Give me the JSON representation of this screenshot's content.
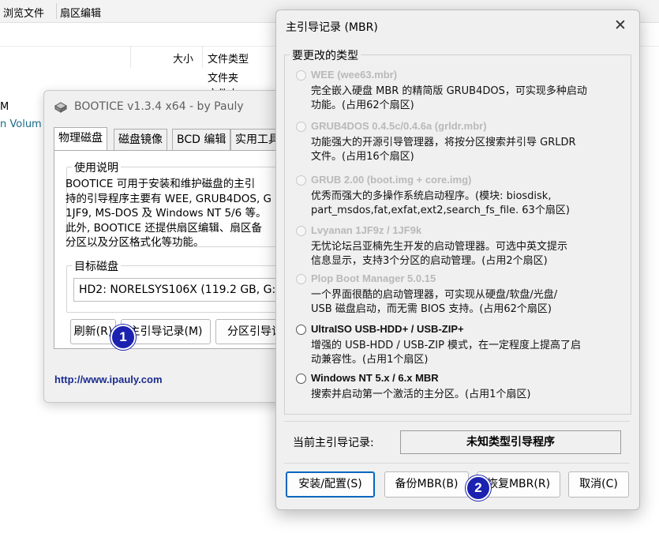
{
  "explorer": {
    "menu": [
      "浏览文件",
      "扇区编辑"
    ],
    "columns": {
      "size": "大小",
      "type": "文件类型"
    },
    "rows": [
      "文件夹",
      "文件夹"
    ],
    "left_text_1": "M",
    "left_text_2": "n Volum"
  },
  "bootice": {
    "title": "BOOTICE v1.3.4 x64 - by Pauly",
    "tabs": [
      "物理磁盘",
      "磁盘镜像",
      "BCD 编辑",
      "实用工具"
    ],
    "usage_label": "使用说明",
    "usage_text": "BOOTICE 可用于安装和维护磁盘的主引\n持的引导程序主要有 WEE, GRUB4DOS, G\n1JF9, MS-DOS 及 Windows NT 5/6 等。\n此外, BOOTICE 还提供扇区编辑、扇区备\n分区以及分区格式化等功能。",
    "target_label": "目标磁盘",
    "target_disk": "HD2: NORELSYS106X (119.2 GB, G:",
    "buttons": {
      "refresh": "刷新(R)",
      "mbr": "主引导记录(M)",
      "pbr": "分区引导记"
    },
    "link": "http://www.ipauly.com"
  },
  "mbr_dialog": {
    "title": "主引导记录 (MBR)",
    "close_glyph": "✕",
    "group_label": "要更改的类型",
    "options": [
      {
        "title": "WEE (wee63.mbr)",
        "desc": "完全嵌入硬盘 MBR 的精简版 GRUB4DOS，可实现多种启动\n功能。(占用62个扇区)",
        "enabled": false
      },
      {
        "title": "GRUB4DOS 0.4.5c/0.4.6a (grldr.mbr)",
        "desc": "功能强大的开源引导管理器，将按分区搜索并引导 GRLDR\n文件。(占用16个扇区)",
        "enabled": false
      },
      {
        "title": "GRUB 2.00 (boot.img + core.img)",
        "desc": "优秀而强大的多操作系统启动程序。(模块: biosdisk,\npart_msdos,fat,exfat,ext2,search_fs_file. 63个扇区)",
        "enabled": false
      },
      {
        "title": "Lvyanan 1JF9z / 1JF9k",
        "desc": "无忧论坛吕亚楠先生开发的启动管理器。可选中英文提示\n信息显示，支持3个分区的启动管理。(占用2个扇区)",
        "enabled": false
      },
      {
        "title": "Plop Boot Manager 5.0.15",
        "desc": "一个界面很酷的启动管理器，可实现从硬盘/软盘/光盘/\nUSB 磁盘启动，而无需 BIOS 支持。(占用62个扇区)",
        "enabled": false
      },
      {
        "title": "UltraISO USB-HDD+ / USB-ZIP+",
        "desc": "增强的 USB-HDD / USB-ZIP 模式，在一定程度上提高了启\n动兼容性。(占用1个扇区)",
        "enabled": true
      },
      {
        "title": "Windows NT 5.x / 6.x MBR",
        "desc": "搜索并启动第一个激活的主分区。(占用1个扇区)",
        "enabled": true
      }
    ],
    "current_label": "当前主引导记录:",
    "current_value": "未知类型引导程序",
    "buttons": {
      "install": "安装/配置(S)",
      "backup": "备份MBR(B)",
      "restore": "恢复MBR(R)",
      "cancel": "取消(C)"
    }
  },
  "badges": [
    "1",
    "2"
  ],
  "colors": {
    "badge": "#1b22b0",
    "link": "#1a2c8f",
    "disabled_text": "#b9b9b9"
  }
}
